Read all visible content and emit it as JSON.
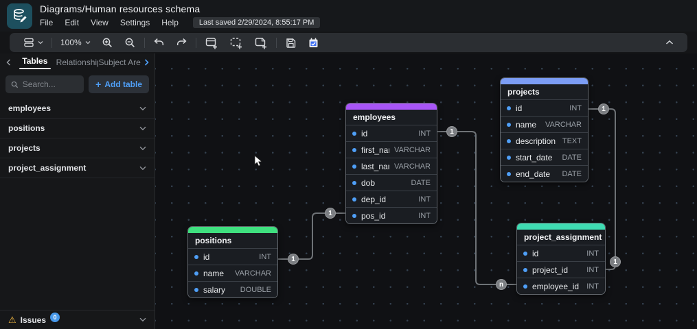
{
  "titlebar": {
    "title": "Diagrams/Human resources schema",
    "menu": [
      "File",
      "Edit",
      "View",
      "Settings",
      "Help"
    ],
    "last_saved": "Last saved 2/29/2024, 8:55:17 PM"
  },
  "toolbar": {
    "zoom_level": "100%"
  },
  "sidebar": {
    "tabs": [
      {
        "label": "Tables"
      },
      {
        "label": "Relationships"
      },
      {
        "label": "Subject Are"
      }
    ],
    "search_placeholder": "Search...",
    "add_table_label": "Add table",
    "tables": [
      "employees",
      "positions",
      "projects",
      "project_assignment"
    ],
    "issues_label": "Issues",
    "issues_count": "0"
  },
  "diagram": {
    "tables": [
      {
        "name": "employees",
        "color": "#a855f7",
        "fields": [
          {
            "name": "id",
            "type": "INT"
          },
          {
            "name": "first_name",
            "type": "VARCHAR"
          },
          {
            "name": "last_name",
            "type": "VARCHAR"
          },
          {
            "name": "dob",
            "type": "DATE"
          },
          {
            "name": "dep_id",
            "type": "INT"
          },
          {
            "name": "pos_id",
            "type": "INT"
          }
        ]
      },
      {
        "name": "projects",
        "color": "#7c9df5",
        "fields": [
          {
            "name": "id",
            "type": "INT"
          },
          {
            "name": "name",
            "type": "VARCHAR"
          },
          {
            "name": "description",
            "type": "TEXT"
          },
          {
            "name": "start_date",
            "type": "DATE"
          },
          {
            "name": "end_date",
            "type": "DATE"
          }
        ]
      },
      {
        "name": "positions",
        "color": "#3fe07f",
        "fields": [
          {
            "name": "id",
            "type": "INT"
          },
          {
            "name": "name",
            "type": "VARCHAR"
          },
          {
            "name": "salary",
            "type": "DOUBLE"
          }
        ]
      },
      {
        "name": "project_assignment",
        "color": "#3fdcb2",
        "fields": [
          {
            "name": "id",
            "type": "INT"
          },
          {
            "name": "project_id",
            "type": "INT"
          },
          {
            "name": "employee_id",
            "type": "INT"
          }
        ]
      }
    ],
    "relationships": [
      {
        "from": "employees.id",
        "from_label": "1",
        "to": "project_assignment.employee_id",
        "to_label": "n"
      },
      {
        "from": "projects.id",
        "from_label": "1",
        "to": "project_assignment.project_id",
        "to_label": "1"
      },
      {
        "from": "positions.id",
        "from_label": "1",
        "to": "employees.pos_id",
        "to_label": "1"
      }
    ]
  },
  "icons": {
    "plus": "+",
    "warning": "⚠"
  }
}
